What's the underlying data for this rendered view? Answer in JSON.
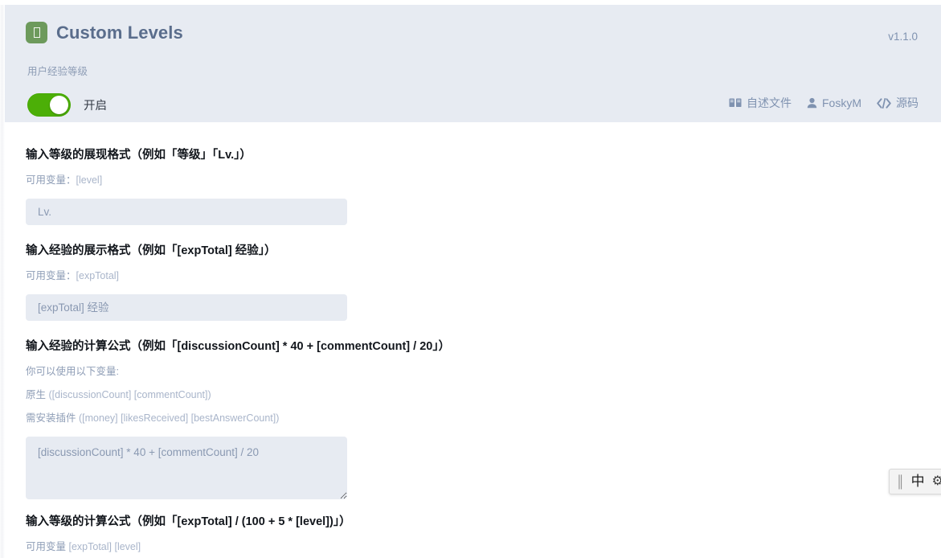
{
  "header": {
    "logo_icon": "tofu-box-icon",
    "title": "Custom Levels",
    "version": "v1.1.0",
    "subtitle": "用户经验等级",
    "toggle": {
      "state_label": "开启",
      "enabled": true,
      "on_color": "#4caf07"
    },
    "links": [
      {
        "icon": "book-icon",
        "label": "自述文件"
      },
      {
        "icon": "person-icon",
        "label": "FoskyM"
      },
      {
        "icon": "code-icon",
        "label": "源码"
      }
    ],
    "bg_color": "#e7ebf2",
    "title_color": "#5a6d8c"
  },
  "form": {
    "fields": [
      {
        "title": "输入等级的展现格式（例如「等级」「Lv.」）",
        "hint_label": "可用变量：",
        "hint_vars": "[level]",
        "input_type": "text",
        "placeholder": "Lv.",
        "value": ""
      },
      {
        "title": "输入经验的展示格式（例如「[expTotal] 经验」）",
        "hint_label": "可用变量：",
        "hint_vars": "[expTotal]",
        "input_type": "text",
        "placeholder": "[expTotal] 经验",
        "value": ""
      },
      {
        "title": "输入经验的计算公式（例如「[discussionCount] * 40 + [commentCount] / 20」）",
        "hint_intro": "你可以使用以下变量:",
        "hint_native_label": "原生",
        "hint_native_vars": "([discussionCount] [commentCount])",
        "hint_plugin_label": "需安装插件",
        "hint_plugin_vars": "([money] [likesReceived] [bestAnswerCount])",
        "input_type": "textarea",
        "placeholder": "[discussionCount] * 40 + [commentCount] / 20",
        "value": ""
      },
      {
        "title": "输入等级的计算公式（例如「[expTotal] / (100 + 5 * [level])」）",
        "hint_label": "可用变量",
        "hint_vars": "[expTotal] [level]",
        "input_type": "text",
        "placeholder": "",
        "value": ""
      }
    ],
    "input_bg": "#e7ebf2",
    "placeholder_color": "#8a99b2"
  },
  "ime_bar": {
    "grip_icon": "drag-grip-icon",
    "mode_label": "中",
    "gear_icon": "gear-icon"
  }
}
